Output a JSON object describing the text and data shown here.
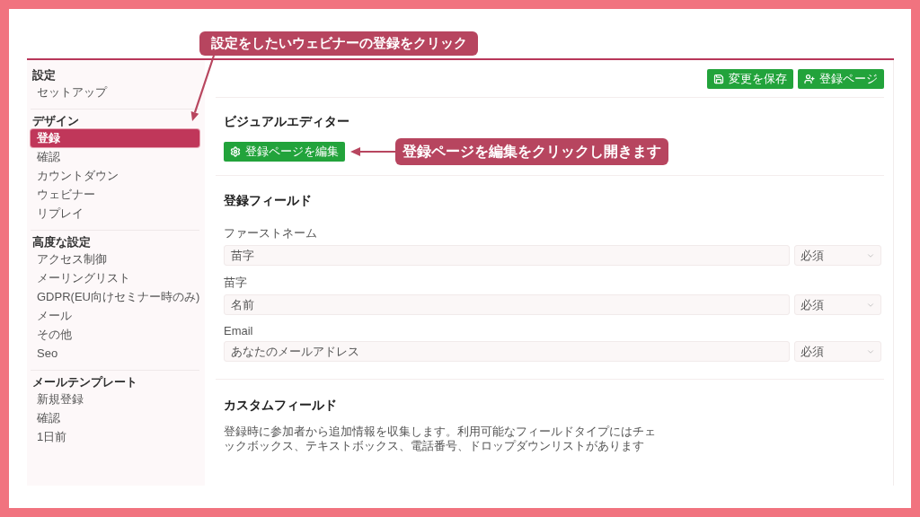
{
  "annotations": [
    {
      "text": "設定をしたいウェビナーの登録をクリック"
    },
    {
      "text": "登録ページを編集をクリックし開きます"
    }
  ],
  "sidebar": {
    "sections": [
      {
        "title": "設定",
        "items": [
          {
            "label": "セットアップ",
            "selected": false
          }
        ]
      },
      {
        "title": "デザイン",
        "items": [
          {
            "label": "登録",
            "selected": true
          },
          {
            "label": "確認",
            "selected": false
          },
          {
            "label": "カウントダウン",
            "selected": false
          },
          {
            "label": "ウェビナー",
            "selected": false
          },
          {
            "label": "リプレイ",
            "selected": false
          }
        ]
      },
      {
        "title": "高度な設定",
        "items": [
          {
            "label": "アクセス制御",
            "selected": false
          },
          {
            "label": "メーリングリスト",
            "selected": false
          },
          {
            "label": "GDPR(EU向けセミナー時のみ)",
            "selected": false
          },
          {
            "label": "メール",
            "selected": false
          },
          {
            "label": "その他",
            "selected": false
          },
          {
            "label": "Seo",
            "selected": false
          }
        ]
      },
      {
        "title": "メールテンプレート",
        "items": [
          {
            "label": "新規登録",
            "selected": false
          },
          {
            "label": "確認",
            "selected": false
          },
          {
            "label": "1日前",
            "selected": false
          }
        ]
      }
    ]
  },
  "toolbar": {
    "buttons": [
      {
        "kind": "save",
        "label": "変更を保存"
      },
      {
        "kind": "register",
        "label": "登録ページ"
      }
    ]
  },
  "visual_editor": {
    "title": "ビジュアルエディター",
    "button": "登録ページを編集"
  },
  "registration_fields": {
    "title": "登録フィールド",
    "fields": [
      {
        "label": "ファーストネーム",
        "value": "苗字",
        "requirement": "必須"
      },
      {
        "label": "苗字",
        "value": "名前",
        "requirement": "必須"
      },
      {
        "label": "Email",
        "value": "あなたのメールアドレス",
        "requirement": "必須"
      }
    ]
  },
  "custom_fields": {
    "title": "カスタムフィールド",
    "description": "登録時に参加者から追加情報を収集します。利用可能なフィールドタイプにはチェックボックス、テキストボックス、電話番号、ドロップダウンリストがあります"
  }
}
